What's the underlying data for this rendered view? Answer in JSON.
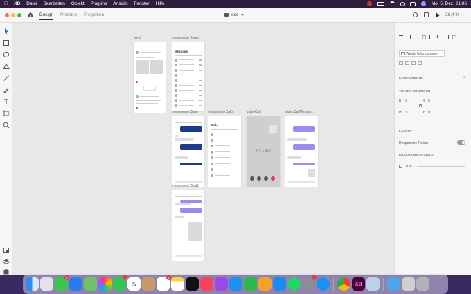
{
  "menubar": {
    "app_name": "XD",
    "items": [
      "Datei",
      "Bearbeiten",
      "Objekt",
      "Plug-ins",
      "Ansicht",
      "Fenster",
      "Hilfe"
    ],
    "datetime": "Mo. 5. Dez. 21:06"
  },
  "titlebar": {
    "tabs": [
      "Design",
      "Prototyp",
      "Freigeben"
    ],
    "active_tab": "Design",
    "document_title": "eco",
    "zoom": "26,4 %"
  },
  "artboards": {
    "feed": "feed",
    "messengerHome": "messengerHome",
    "messengerChat": "messengerChat",
    "messengerCalls": "messengerCalls",
    "videoCall": "videoCall",
    "videoCallMessenger": "videoCallMessen...",
    "messengerChat1": "messengerChat1",
    "home_title": "Message",
    "calls_title": "Calls",
    "video_size": "375 x 812"
  },
  "right_panel": {
    "repeat_grid": "Wiederholungsraster",
    "components": "KOMPONENTE",
    "transform": "TRANSFORMIEREN",
    "w_label": "B",
    "w_value": "0",
    "x_label": "X",
    "x_value": "0",
    "h_label": "H",
    "h_value": "0",
    "y_label": "Y",
    "y_value": "0",
    "layout": "LAYOUT",
    "responsive_resize": "Responsive Resize",
    "appearance": "ERSCHEINUNGSBILD",
    "opacity": "0 %"
  },
  "dock": {
    "mail_badge": "1",
    "facetime_badge": "1",
    "reminders_badge": "1",
    "settings_badge": "1",
    "calendar_day": "5"
  },
  "colors": {
    "accent_blue": "#1473e6",
    "chat_blue": "#1e3a8a",
    "chat_purple": "#9b8cf2",
    "end_call_red": "#e63950"
  }
}
